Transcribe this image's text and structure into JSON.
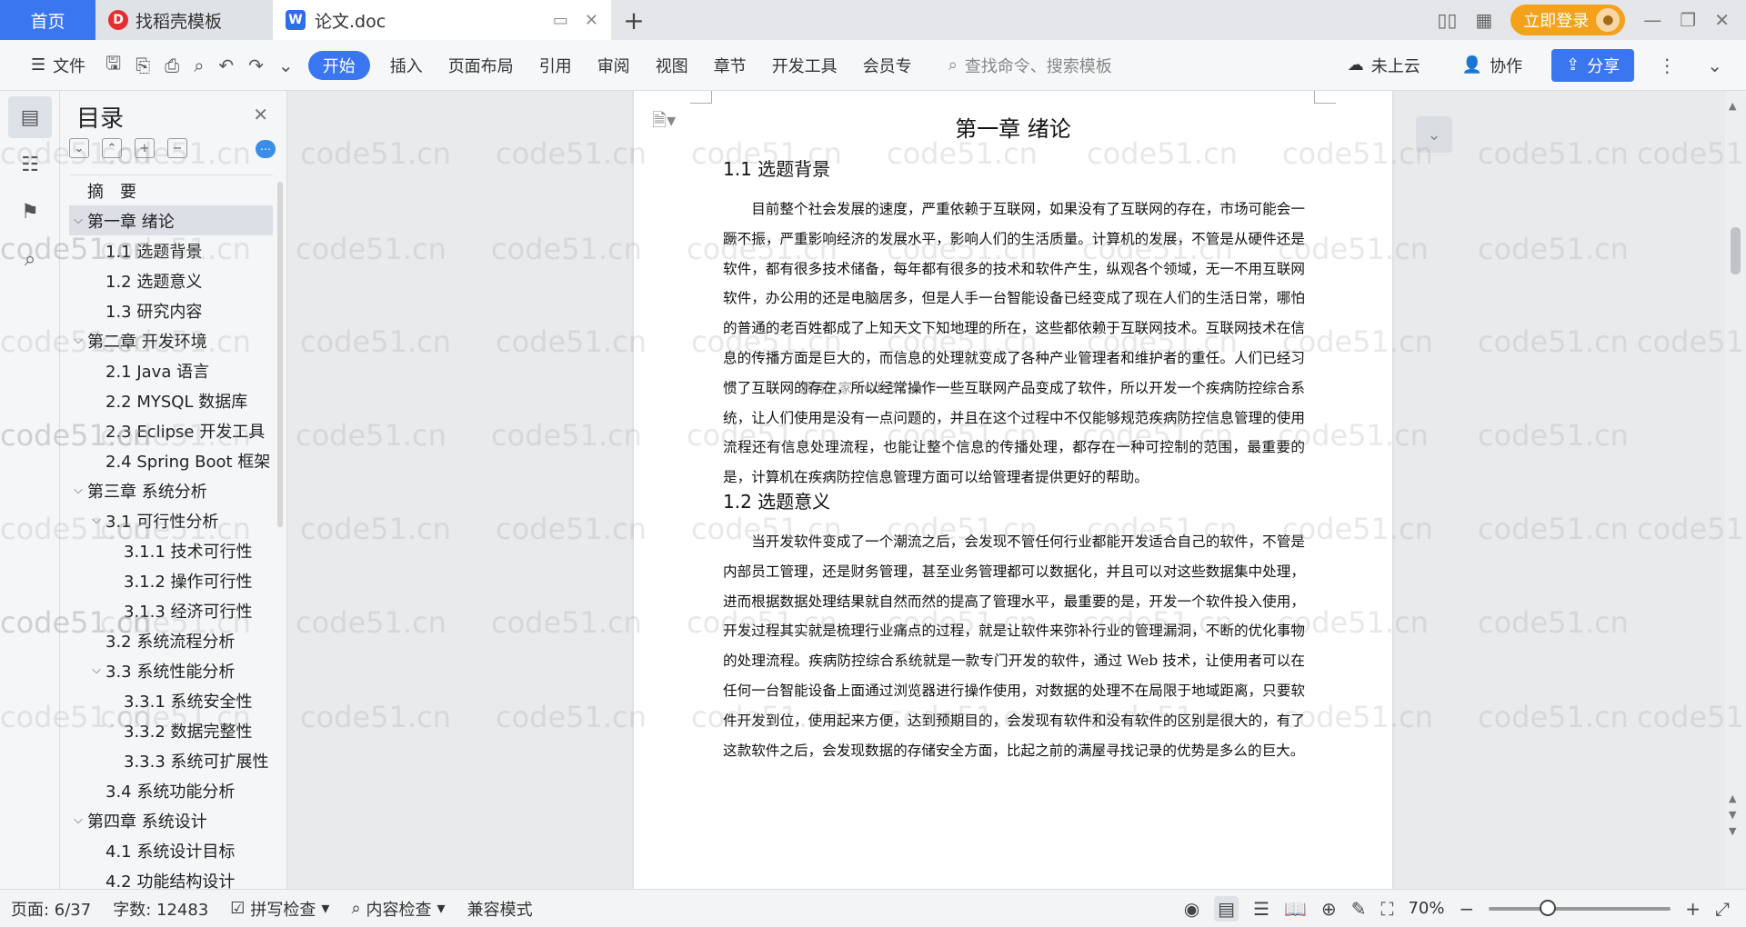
{
  "tabs": {
    "home": "首页",
    "template": "找稻壳模板",
    "doc": "论文.doc",
    "login": "立即登录"
  },
  "toolbar": {
    "file": "文件",
    "menus": [
      "开始",
      "插入",
      "页面布局",
      "引用",
      "审阅",
      "视图",
      "章节",
      "开发工具",
      "会员专"
    ],
    "search": "查找命令、搜索模板",
    "cloud": "未上云",
    "collab": "协作",
    "share": "分享"
  },
  "toc": {
    "title": "目录",
    "items": [
      {
        "label": "摘　要",
        "level": 0,
        "chev": ""
      },
      {
        "label": "第一章  绪论",
        "level": 0,
        "chev": "⌵"
      },
      {
        "label": "1.1  选题背景",
        "level": 1,
        "chev": ""
      },
      {
        "label": "1.2  选题意义",
        "level": 1,
        "chev": ""
      },
      {
        "label": "1.3  研究内容",
        "level": 1,
        "chev": ""
      },
      {
        "label": "第二章  开发环境",
        "level": 0,
        "chev": "⌵"
      },
      {
        "label": "2.1 Java 语言",
        "level": 1,
        "chev": ""
      },
      {
        "label": "2.2 MYSQL 数据库",
        "level": 1,
        "chev": ""
      },
      {
        "label": "2.3 Eclipse 开发工具",
        "level": 1,
        "chev": ""
      },
      {
        "label": "2.4 Spring Boot 框架",
        "level": 1,
        "chev": ""
      },
      {
        "label": "第三章  系统分析",
        "level": 0,
        "chev": "⌵"
      },
      {
        "label": "3.1 可行性分析",
        "level": 1,
        "chev": "⌵"
      },
      {
        "label": "3.1.1 技术可行性",
        "level": 2,
        "chev": ""
      },
      {
        "label": "3.1.2 操作可行性",
        "level": 2,
        "chev": ""
      },
      {
        "label": "3.1.3 经济可行性",
        "level": 2,
        "chev": ""
      },
      {
        "label": "3.2 系统流程分析",
        "level": 1,
        "chev": ""
      },
      {
        "label": "3.3 系统性能分析",
        "level": 1,
        "chev": "⌵"
      },
      {
        "label": "3.3.1 系统安全性",
        "level": 2,
        "chev": ""
      },
      {
        "label": "3.3.2 数据完整性",
        "level": 2,
        "chev": ""
      },
      {
        "label": "3.3.3 系统可扩展性",
        "level": 2,
        "chev": ""
      },
      {
        "label": "3.4 系统功能分析",
        "level": 1,
        "chev": ""
      },
      {
        "label": "第四章  系统设计",
        "level": 0,
        "chev": "⌵"
      },
      {
        "label": "4.1  系统设计目标",
        "level": 1,
        "chev": ""
      },
      {
        "label": "4.2 功能结构设计",
        "level": 1,
        "chev": ""
      }
    ]
  },
  "document": {
    "chapter": "第一章  绪论",
    "sec1": "1.1  选题背景",
    "para1": "目前整个社会发展的速度，严重依赖于互联网，如果没有了互联网的存在，市场可能会一蹶不振，严重影响经济的发展水平，影响人们的生活质量。计算机的发展，不管是从硬件还是软件，都有很多技术储备，每年都有很多的技术和软件产生，纵观各个领域，无一不用互联网软件，办公用的还是电脑居多，但是人手一台智能设备已经变成了现在人们的生活日常，哪怕的普通的老百姓都成了上知天文下知地理的所在，这些都依赖于互联网技术。互联网技术在信息的传播方面是巨大的，而信息的处理就变成了各种产业管理者和维护者的重任。人们已经习惯了互联网的存在，所以经常操作一些互联网产品变成了软件，所以开发一个疾病防控综合系统，让人们使用是没有一点问题的，并且在这个过程中不仅能够规范疾病防控信息管理的使用流程还有信息处理流程，也能让整个信息的传播处理，都存在一种可控制的范围，最重要的是，计算机在疾病防控信息管理方面可以给管理者提供更好的帮助。",
    "sec2": "1.2  选题意义",
    "para2": "当开发软件变成了一个潮流之后，会发现不管任何行业都能开发适合自己的软件，不管是内部员工管理，还是财务管理，甚至业务管理都可以数据化，并且可以对这些数据集中处理，进而根据数据处理结果就自然而然的提高了管理水平，最重要的是，开发一个软件投入使用，开发过程其实就是梳理行业痛点的过程，就是让软件来弥补行业的管理漏洞，不断的优化事物的处理流程。疾病防控综合系统就是一款专门开发的软件，通过 Web 技术，让使用者可以在任何一台智能设备上面通过浏览器进行操作使用，对数据的处理不在局限于地域距离，只要软件开发到位，使用起来方便，达到预期目的，会发现有软件和没有软件的区别是很大的，有了这款软件之后，会发现数据的存储安全方面，比起之前的满屋寻找记录的优势是多么的巨大。",
    "overlay": "源码之家 code51.cn"
  },
  "watermark": "code51.cn",
  "status": {
    "page": "页面: 6/37",
    "words": "字数: 12483",
    "spell": "拼写检查",
    "content": "内容检查",
    "mode": "兼容模式",
    "zoom": "70%",
    "zoom_fraction": 0.28
  }
}
